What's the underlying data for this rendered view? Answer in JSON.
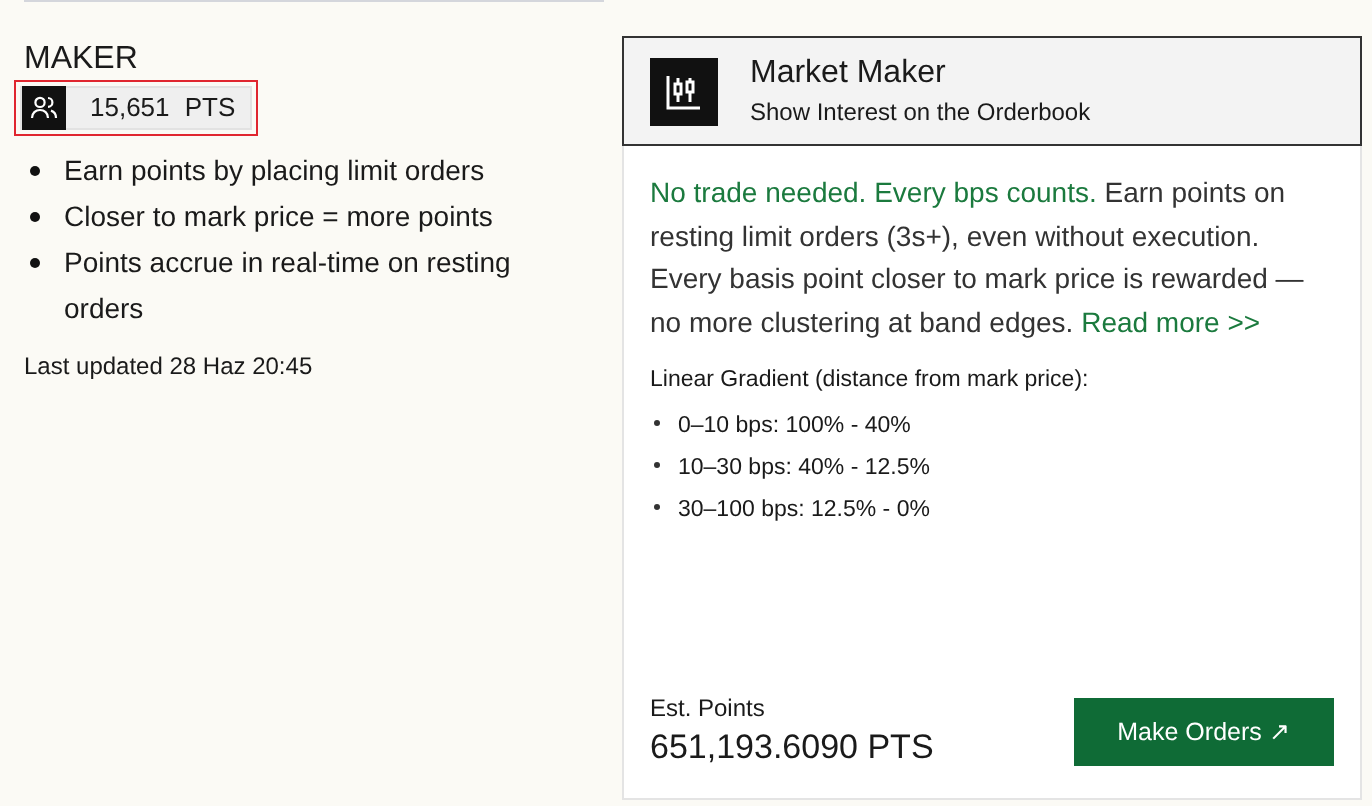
{
  "section": {
    "title": "MAKER",
    "badge": {
      "value": "15,651",
      "unit": "PTS",
      "highlighted": true
    },
    "bullets": [
      "Earn points by placing limit orders",
      "Closer to mark price = more points",
      "Points accrue in real-time on resting orders"
    ],
    "updated": "Last updated 28 Haz 20:45"
  },
  "card": {
    "title": "Market Maker",
    "subtitle": "Show Interest on the Orderbook",
    "intro": {
      "highlight": "No trade needed. Every bps counts.",
      "text": " Earn points on resting limit orders (3s+), even without execution. Every basis point closer to mark price is rewarded — no more clustering at band edges. ",
      "link": "Read more >>"
    },
    "gradient_title": "Linear Gradient (distance from mark price):",
    "gradient": [
      "0–10 bps: 100% - 40%",
      "10–30 bps: 40% - 12.5%",
      "30–100 bps: 12.5% - 0%"
    ],
    "est_label": "Est. Points",
    "est_value": "651,193.6090 PTS",
    "button": "Make Orders ↗"
  }
}
